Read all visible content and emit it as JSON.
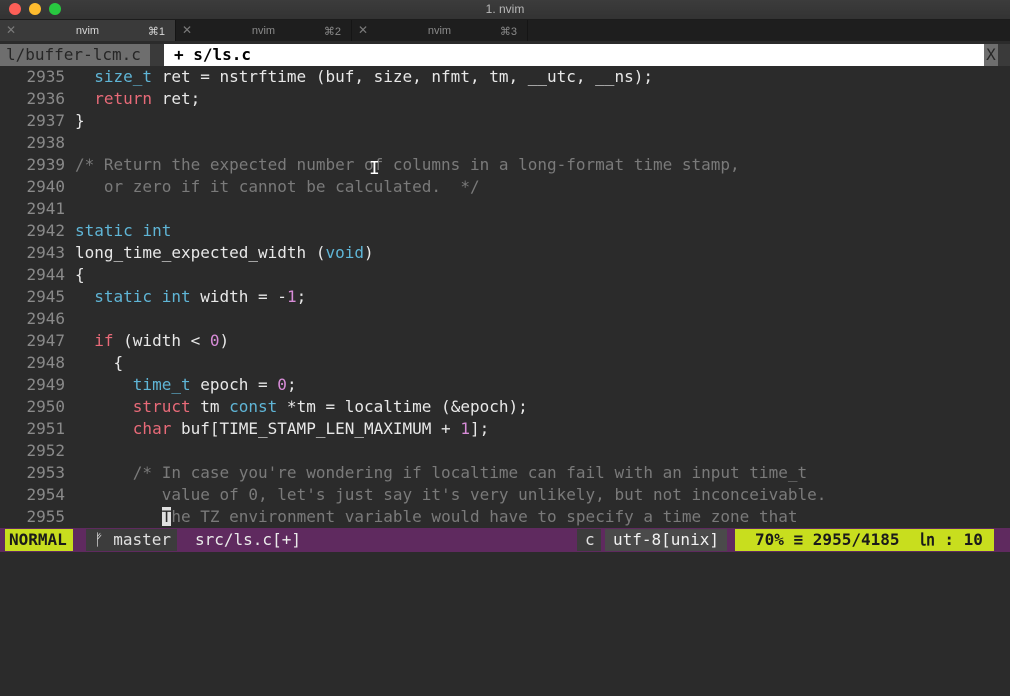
{
  "window": {
    "title": "1. nvim"
  },
  "terminal_tabs": [
    {
      "name": "nvim",
      "shortcut": "⌘1",
      "active": true
    },
    {
      "name": "nvim",
      "shortcut": "⌘2",
      "active": false
    },
    {
      "name": "nvim",
      "shortcut": "⌘3",
      "active": false
    }
  ],
  "vim_tabline": {
    "inactive_tab": "l/buffer-lcm.c",
    "active_tab": "+ s/ls.c",
    "close": "X"
  },
  "code_lines": [
    {
      "n": "2935",
      "tokens": [
        [
          "",
          "  "
        ],
        [
          "ty",
          "size_t"
        ],
        [
          "",
          " ret = nstrftime (buf, size, nfmt, tm, __utc, __ns);"
        ]
      ]
    },
    {
      "n": "2936",
      "tokens": [
        [
          "",
          "  "
        ],
        [
          "kw",
          "return"
        ],
        [
          "",
          " ret;"
        ]
      ]
    },
    {
      "n": "2937",
      "tokens": [
        [
          "",
          "}"
        ]
      ]
    },
    {
      "n": "2938",
      "tokens": []
    },
    {
      "n": "2939",
      "tokens": [
        [
          "cm",
          "/* Return the expected number of columns in a long-format time stamp,"
        ]
      ]
    },
    {
      "n": "2940",
      "tokens": [
        [
          "cm",
          "   or zero if it cannot be calculated.  */"
        ]
      ]
    },
    {
      "n": "2941",
      "tokens": []
    },
    {
      "n": "2942",
      "tokens": [
        [
          "ty",
          "static"
        ],
        [
          "",
          " "
        ],
        [
          "ty",
          "int"
        ]
      ]
    },
    {
      "n": "2943",
      "tokens": [
        [
          "",
          "long_time_expected_width ("
        ],
        [
          "ty",
          "void"
        ],
        [
          "",
          ")"
        ]
      ]
    },
    {
      "n": "2944",
      "tokens": [
        [
          "",
          "{"
        ]
      ]
    },
    {
      "n": "2945",
      "tokens": [
        [
          "",
          "  "
        ],
        [
          "ty",
          "static"
        ],
        [
          "",
          " "
        ],
        [
          "ty",
          "int"
        ],
        [
          "",
          " width = -"
        ],
        [
          "num",
          "1"
        ],
        [
          "",
          ";"
        ]
      ]
    },
    {
      "n": "2946",
      "tokens": []
    },
    {
      "n": "2947",
      "tokens": [
        [
          "",
          "  "
        ],
        [
          "kw",
          "if"
        ],
        [
          "",
          " (width < "
        ],
        [
          "num",
          "0"
        ],
        [
          "",
          ")"
        ]
      ]
    },
    {
      "n": "2948",
      "tokens": [
        [
          "",
          "    {"
        ]
      ]
    },
    {
      "n": "2949",
      "tokens": [
        [
          "",
          "      "
        ],
        [
          "ty",
          "time_t"
        ],
        [
          "",
          " epoch = "
        ],
        [
          "num",
          "0"
        ],
        [
          "",
          ";"
        ]
      ]
    },
    {
      "n": "2950",
      "tokens": [
        [
          "",
          "      "
        ],
        [
          "kw",
          "struct"
        ],
        [
          "",
          " tm "
        ],
        [
          "ty",
          "const"
        ],
        [
          "",
          " *tm = localtime (&epoch);"
        ]
      ]
    },
    {
      "n": "2951",
      "tokens": [
        [
          "",
          "      "
        ],
        [
          "kw",
          "char"
        ],
        [
          "",
          " buf[TIME_STAMP_LEN_MAXIMUM + "
        ],
        [
          "num",
          "1"
        ],
        [
          "",
          "];"
        ]
      ]
    },
    {
      "n": "2952",
      "tokens": []
    },
    {
      "n": "2953",
      "tokens": [
        [
          "",
          "      "
        ],
        [
          "cm",
          "/* In case you're wondering if localtime can fail with an input time_t"
        ]
      ]
    },
    {
      "n": "2954",
      "tokens": [
        [
          "",
          "         "
        ],
        [
          "cm",
          "value of 0, let's just say it's very unlikely, but not inconceivable."
        ]
      ]
    },
    {
      "n": "2955",
      "tokens": [
        [
          "",
          "         "
        ],
        [
          "cursor",
          "T"
        ],
        [
          "cm",
          "he TZ environment variable would have to specify a time zone that"
        ]
      ]
    }
  ],
  "statusline": {
    "mode": "NORMAL",
    "branch": "ᚠ master",
    "file": "src/ls.c[+]",
    "filetype": "c",
    "encoding": "utf-8[unix]",
    "position": "70% ≡ 2955/4185  ㏑ : 10"
  },
  "colors": {
    "keyword": "#e86a78",
    "type": "#5fb5d6",
    "number": "#d88cd8",
    "comment": "#7a7a7a",
    "mode_bg": "#c8de1e",
    "statusline_bg": "#5f2a5f"
  }
}
